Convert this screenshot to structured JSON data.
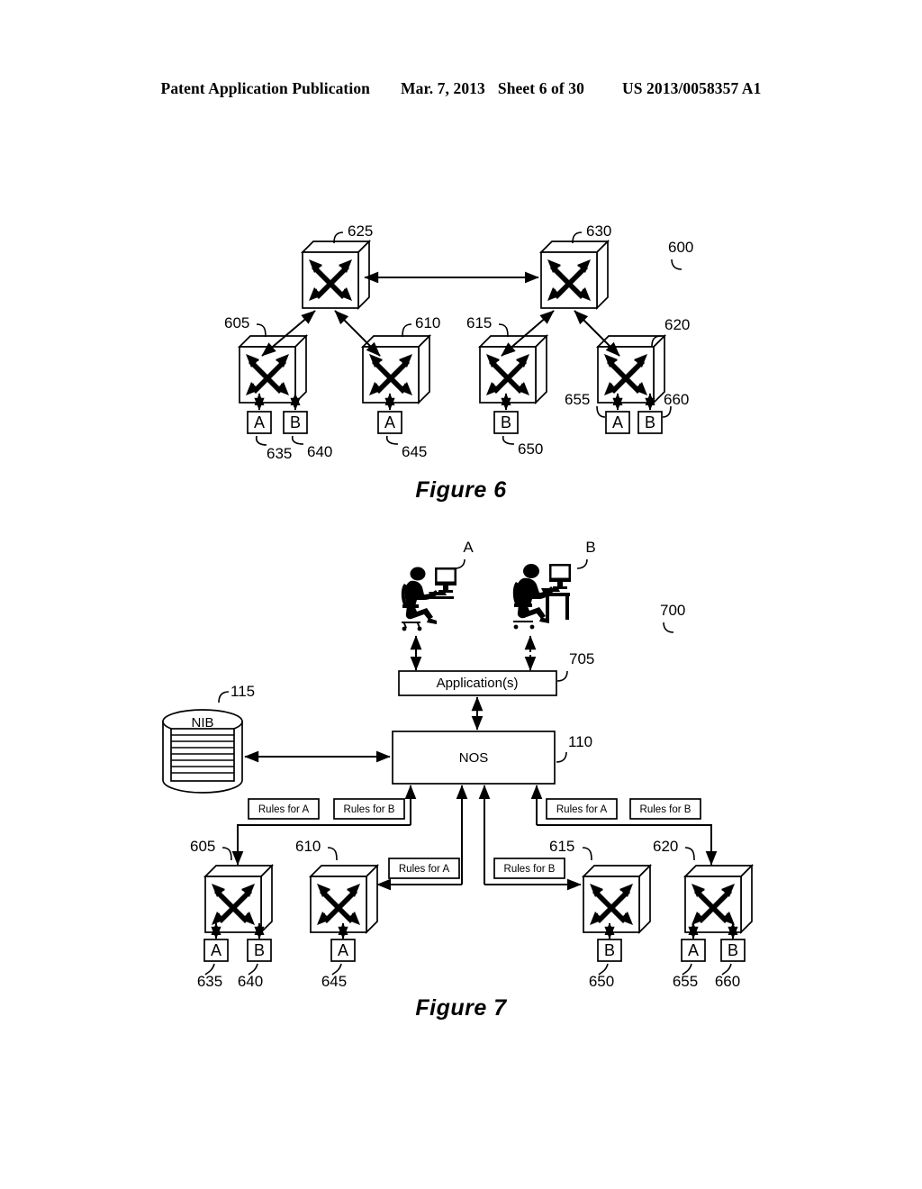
{
  "header": {
    "publication": "Patent Application Publication",
    "date": "Mar. 7, 2013",
    "sheet": "Sheet 6 of 30",
    "patent_number": "US 2013/0058357 A1"
  },
  "figure6": {
    "caption": "Figure 6",
    "diagram_ref": "600",
    "core_switches": [
      {
        "ref": "625"
      },
      {
        "ref": "630"
      }
    ],
    "edge_switches": [
      {
        "ref": "605"
      },
      {
        "ref": "610"
      },
      {
        "ref": "615"
      },
      {
        "ref": "620"
      }
    ],
    "endpoints": [
      {
        "label": "A",
        "ref": "635"
      },
      {
        "label": "B",
        "ref": "640"
      },
      {
        "label": "A",
        "ref": "645"
      },
      {
        "label": "B",
        "ref": "650"
      },
      {
        "label": "A",
        "ref": "655"
      },
      {
        "label": "B",
        "ref": "660"
      }
    ]
  },
  "figure7": {
    "caption": "Figure 7",
    "diagram_ref": "700",
    "users": [
      {
        "label": "A"
      },
      {
        "label": "B"
      }
    ],
    "application_box": {
      "label": "Application(s)",
      "ref": "705"
    },
    "nos_box": {
      "label": "NOS",
      "ref": "110"
    },
    "nib_store": {
      "label": "NIB",
      "ref": "115"
    },
    "rules_boxes": [
      {
        "label": "Rules for A"
      },
      {
        "label": "Rules for B"
      },
      {
        "label": "Rules for A"
      },
      {
        "label": "Rules for B"
      },
      {
        "label": "Rules for A"
      },
      {
        "label": "Rules for B"
      }
    ],
    "switches": [
      {
        "ref": "605"
      },
      {
        "ref": "610"
      },
      {
        "ref": "615"
      },
      {
        "ref": "620"
      }
    ],
    "endpoints": [
      {
        "label": "A",
        "ref": "635"
      },
      {
        "label": "B",
        "ref": "640"
      },
      {
        "label": "A",
        "ref": "645"
      },
      {
        "label": "B",
        "ref": "650"
      },
      {
        "label": "A",
        "ref": "655"
      },
      {
        "label": "B",
        "ref": "660"
      }
    ]
  }
}
